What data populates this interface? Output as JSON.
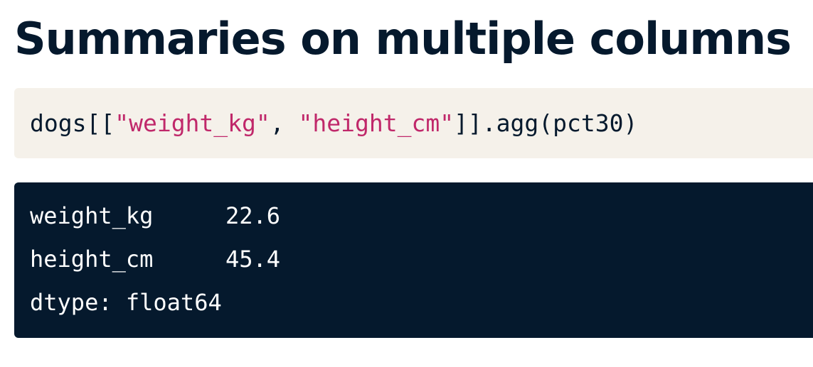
{
  "page": {
    "title": "Summaries on multiple columns"
  },
  "code": {
    "prefix": "dogs[[",
    "string1": "\"weight_kg\"",
    "separator": ", ",
    "string2": "\"height_cm\"",
    "suffix": "]].agg(pct30)"
  },
  "output": {
    "rows": [
      {
        "name": "weight_kg",
        "value": "22.6"
      },
      {
        "name": "height_cm",
        "value": "45.4"
      }
    ],
    "dtype_line": "dtype: float64"
  },
  "colors": {
    "title": "#05192D",
    "code_background": "#F5F1EA",
    "code_string": "#C0286A",
    "output_background": "#05192D",
    "output_text": "#FFFFFF"
  }
}
